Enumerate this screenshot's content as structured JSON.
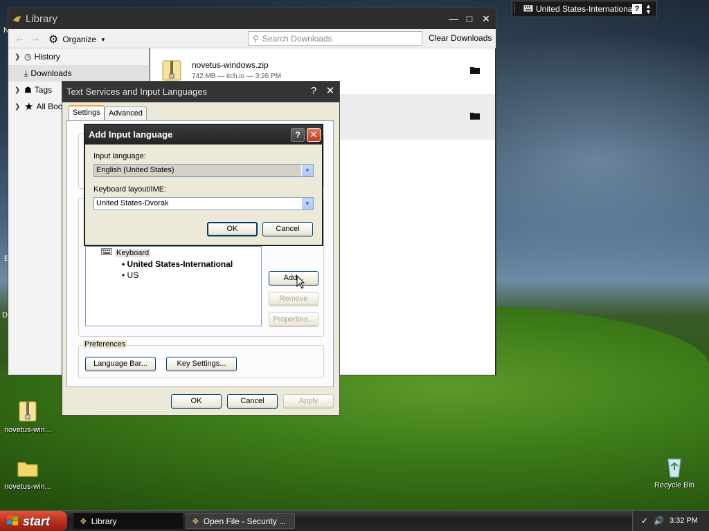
{
  "langbar": {
    "language": "United States-International",
    "help_label": "?",
    "menu_icon": "chevron-down-icon"
  },
  "desktop": {
    "icons": [
      {
        "label": "novetus-win...",
        "icon": "zip-file-icon"
      },
      {
        "label": "novetus-win...",
        "icon": "folder-icon"
      },
      {
        "label": "Recycle Bin",
        "icon": "recycle-bin-icon"
      }
    ],
    "edge_letters": [
      "N",
      "E",
      "D"
    ]
  },
  "library": {
    "title": "Library",
    "organize_label": "Organize",
    "search_placeholder": "Search Downloads",
    "clear_label": "Clear Downloads",
    "sidebar": [
      {
        "label": "History",
        "icon": "clock-icon",
        "expandable": true
      },
      {
        "label": "Downloads",
        "icon": "download-icon",
        "expandable": false
      },
      {
        "label": "Tags",
        "icon": "tag-icon",
        "expandable": true
      },
      {
        "label": "All Bookmarks",
        "icon": "star-icon",
        "expandable": true
      }
    ],
    "downloads": [
      {
        "name": "novetus-windows.zip",
        "meta": "742 MB — itch.io — 3:26 PM"
      },
      {
        "name": "",
        "meta": ""
      }
    ]
  },
  "text_services": {
    "title": "Text Services and Input Languages",
    "tabs": [
      "Settings",
      "Advanced"
    ],
    "help_label": "?",
    "keyboard_label": "Keyboard",
    "keyboard_items": [
      "United States-International",
      "US"
    ],
    "side_buttons": {
      "add": "Add...",
      "remove": "Remove",
      "properties": "Properties..."
    },
    "preferences": {
      "title": "Preferences",
      "language_bar": "Language Bar...",
      "key_settings": "Key Settings..."
    },
    "footer": {
      "ok": "OK",
      "cancel": "Cancel",
      "apply": "Apply"
    }
  },
  "add_language": {
    "title": "Add Input language",
    "help_label": "?",
    "input_language_label": "Input language:",
    "input_language_value": "English (United States)",
    "keyboard_layout_label": "Keyboard layout/IME:",
    "keyboard_layout_value": "United States-Dvorak",
    "ok": "OK",
    "cancel": "Cancel"
  },
  "taskbar": {
    "start_label": "start",
    "tasks": [
      {
        "label": "Library",
        "icon": "library-icon",
        "active": true
      },
      {
        "label": "Open File - Security ...",
        "icon": "security-icon",
        "active": false
      }
    ],
    "clock": "3:32 PM"
  }
}
